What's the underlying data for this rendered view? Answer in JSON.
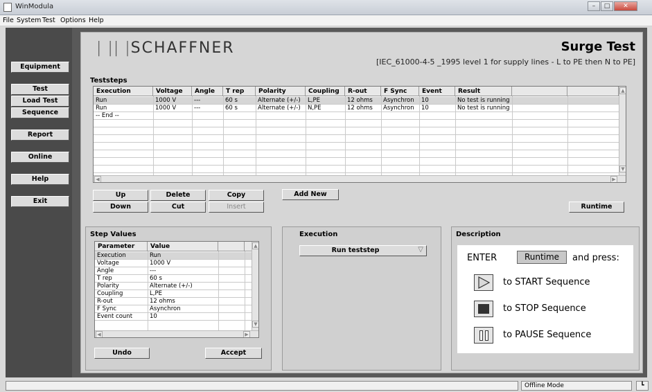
{
  "window": {
    "title": "WinModula"
  },
  "menu": [
    "File",
    "System",
    "Test",
    "Options",
    "Help"
  ],
  "sidebar": {
    "items": [
      {
        "label": "Equipment"
      },
      {
        "label": "Test"
      },
      {
        "label": "Load Test"
      },
      {
        "label": "Sequence"
      },
      {
        "label": "Report"
      },
      {
        "label": "Online"
      },
      {
        "label": "Help"
      },
      {
        "label": "Exit"
      }
    ]
  },
  "header": {
    "logo_bars": "| || |",
    "logo_text": "SCHAFFNER",
    "test_title": "Surge Test",
    "standard": "[IEC_61000-4-5 _1995 level 1 for supply lines - L to PE then N to PE]"
  },
  "teststeps": {
    "title": "Teststeps",
    "columns": [
      "Execution",
      "Voltage",
      "Angle",
      "T rep",
      "Polarity",
      "Coupling",
      "R-out",
      "F Sync",
      "Event cour",
      "Result",
      "",
      ""
    ],
    "rows": [
      [
        "Run",
        "1000 V",
        "---",
        "60 s",
        "Alternate (+/-)",
        "L,PE",
        "12 ohms",
        "Asynchron",
        "10",
        "No test is running",
        "",
        ""
      ],
      [
        "Run",
        "1000 V",
        "---",
        "60 s",
        "Alternate (+/-)",
        "N,PE",
        "12 ohms",
        "Asynchron",
        "10",
        "No test is running",
        "",
        ""
      ],
      [
        "-- End --",
        "",
        "",
        "",
        "",
        "",
        "",
        "",
        "",
        "",
        "",
        ""
      ]
    ],
    "buttons": {
      "up": "Up",
      "delete": "Delete",
      "copy": "Copy",
      "add_new": "Add New",
      "down": "Down",
      "cut": "Cut",
      "insert": "Insert",
      "runtime": "Runtime"
    }
  },
  "step_values": {
    "title": "Step Values",
    "columns": [
      "Parameter",
      "Value",
      "",
      ""
    ],
    "rows": [
      [
        "Execution",
        "Run"
      ],
      [
        "Voltage",
        "1000 V"
      ],
      [
        "Angle",
        "---"
      ],
      [
        "T rep",
        "60 s"
      ],
      [
        "Polarity",
        "Alternate (+/-)"
      ],
      [
        "Coupling",
        "L,PE"
      ],
      [
        "R-out",
        "12 ohms"
      ],
      [
        "F Sync",
        "Asynchron"
      ],
      [
        "Event count",
        "10"
      ]
    ],
    "buttons": {
      "undo": "Undo",
      "accept": "Accept"
    }
  },
  "execution": {
    "title": "Execution",
    "selected": "Run teststep"
  },
  "description": {
    "title": "Description",
    "enter": "ENTER",
    "runtime": "Runtime",
    "and_press": "and press:",
    "start": "to START Sequence",
    "stop": "to STOP Sequence",
    "pause": "to PAUSE Sequence"
  },
  "status": {
    "mode": "Offline Mode"
  }
}
